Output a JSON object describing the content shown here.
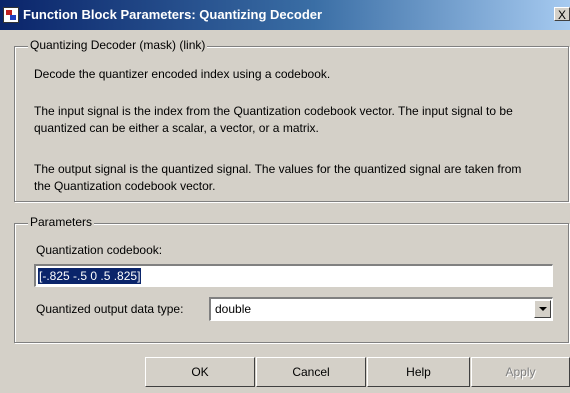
{
  "window": {
    "title": "Function Block Parameters: Quantizing Decoder",
    "close_label": "X"
  },
  "mask_group": {
    "label": "Quantizing Decoder (mask) (link)",
    "description": [
      "Decode the quantizer encoded index using a codebook.",
      "The input signal is the index from the Quantization codebook vector.  The input signal to be quantized can be either a scalar, a vector, or a matrix.",
      "The output signal is the quantized signal.  The values for the quantized signal are taken from the Quantization codebook vector."
    ]
  },
  "parameters_group": {
    "label": "Parameters",
    "codebook_label": "Quantization codebook:",
    "codebook_value": "[-.825 -.5 0 .5 .825]",
    "output_type_label": "Quantized output data type:",
    "output_type_value": "double"
  },
  "buttons": {
    "ok": "OK",
    "cancel": "Cancel",
    "help": "Help",
    "apply": "Apply"
  }
}
